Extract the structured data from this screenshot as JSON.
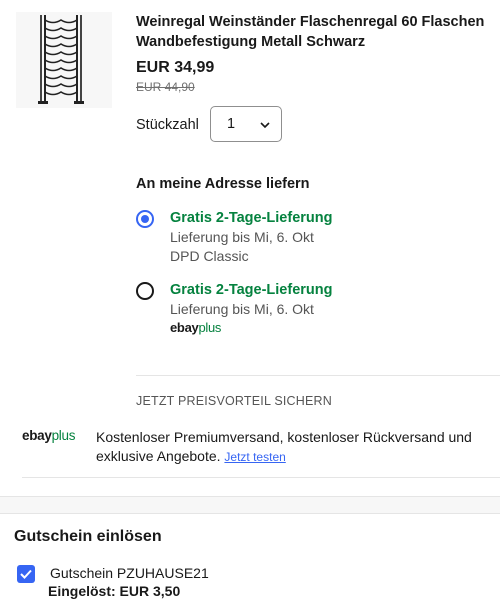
{
  "product": {
    "title": "Weinregal Weinständer Flaschenregal 60 Flaschen Wandbefestigung Metall Schwarz",
    "price": "EUR 34,99",
    "old_price": "EUR 44,90",
    "quantity_label": "Stückzahl",
    "quantity_value": "1"
  },
  "delivery": {
    "heading": "An meine Adresse liefern",
    "options": [
      {
        "title": "Gratis 2-Tage-Lieferung",
        "line1": "Lieferung bis Mi, 6. Okt",
        "line2": "DPD Classic",
        "selected": true
      },
      {
        "title": "Gratis 2-Tage-Lieferung",
        "line1": "Lieferung bis Mi, 6. Okt",
        "badge_ebay": "ebay",
        "badge_plus": "plus",
        "selected": false
      }
    ]
  },
  "promo": {
    "heading": "JETZT PREISVORTEIL SICHERN",
    "logo_ebay": "ebay",
    "logo_plus": "plus",
    "text": "Kostenloser Premiumversand, kostenloser Rückversand und exklusive Angebote.",
    "link": "Jetzt testen"
  },
  "coupon": {
    "heading": "Gutschein einlösen",
    "code_text": "Gutschein PZUHAUSE21",
    "redeemed_text": "Eingelöst: EUR 3,50",
    "checked": true
  },
  "colors": {
    "accent_blue": "#3665f3",
    "delivery_green": "#05823f"
  }
}
